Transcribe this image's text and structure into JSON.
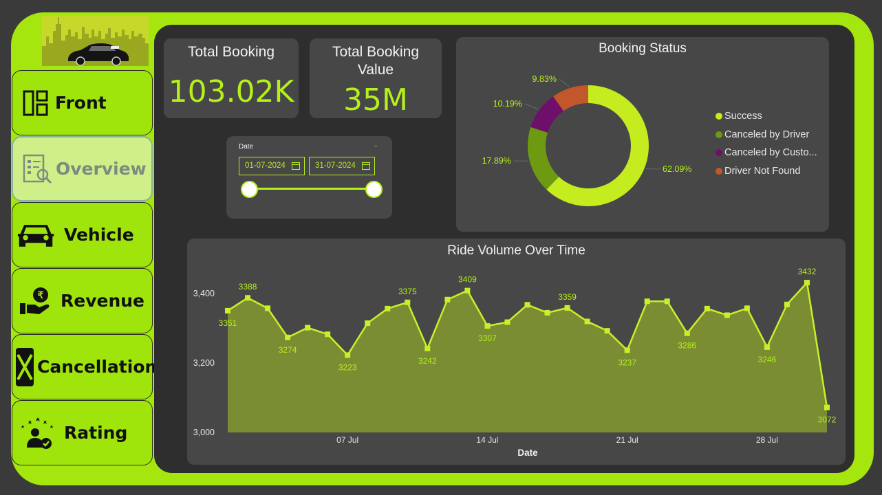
{
  "nav": [
    {
      "label": "Front",
      "icon": "layout-grid-icon"
    },
    {
      "label": "Overview",
      "icon": "report-search-icon"
    },
    {
      "label": "Vehicle",
      "icon": "car-icon"
    },
    {
      "label": "Revenue",
      "icon": "rupee-hand-icon"
    },
    {
      "label": "Cancellation",
      "icon": "cancel-x-icon"
    },
    {
      "label": "Rating",
      "icon": "rating-stars-user-icon"
    }
  ],
  "kpis": {
    "total_booking": {
      "title": "Total Booking",
      "value": "103.02K"
    },
    "total_booking_value": {
      "title_line1": "Total Booking",
      "title_line2": "Value",
      "value": "35M"
    }
  },
  "date_filter": {
    "label": "Date",
    "start": "01-07-2024",
    "end": "31-07-2024"
  },
  "colors": {
    "accent": "#b5f01a",
    "panel_green": "#a6e60f",
    "success": "#c4ec1e",
    "canceled_driver": "#6e9a12",
    "canceled_customer": "#6e0f6a",
    "driver_not_found": "#c2572b"
  },
  "chart_data": [
    {
      "type": "pie",
      "title": "Booking Status",
      "labels": [
        "Success",
        "Canceled by Driver",
        "Canceled by Custo...",
        "Driver Not Found"
      ],
      "values": [
        62.09,
        17.89,
        10.19,
        9.83
      ],
      "value_labels": [
        "62.09%",
        "17.89%",
        "10.19%",
        "9.83%"
      ],
      "legend": "right"
    },
    {
      "type": "area",
      "title": "Ride Volume Over Time",
      "xlabel": "Date",
      "ylabel": "",
      "ylim": [
        3000,
        3440
      ],
      "x_ticks": [
        "07 Jul",
        "14 Jul",
        "21 Jul",
        "28 Jul"
      ],
      "y_ticks": [
        "3,000",
        "3,200",
        "3,400"
      ],
      "x": [
        "2024-07-01",
        "2024-07-02",
        "2024-07-03",
        "2024-07-04",
        "2024-07-05",
        "2024-07-06",
        "2024-07-07",
        "2024-07-08",
        "2024-07-09",
        "2024-07-10",
        "2024-07-11",
        "2024-07-12",
        "2024-07-13",
        "2024-07-14",
        "2024-07-15",
        "2024-07-16",
        "2024-07-17",
        "2024-07-18",
        "2024-07-19",
        "2024-07-20",
        "2024-07-21",
        "2024-07-22",
        "2024-07-23",
        "2024-07-24",
        "2024-07-25",
        "2024-07-26",
        "2024-07-27",
        "2024-07-28",
        "2024-07-29",
        "2024-07-30",
        "2024-07-31"
      ],
      "values": [
        3351,
        3388,
        3358,
        3274,
        3302,
        3283,
        3223,
        3315,
        3357,
        3375,
        3242,
        3383,
        3409,
        3307,
        3318,
        3368,
        3345,
        3359,
        3320,
        3293,
        3237,
        3378,
        3378,
        3286,
        3357,
        3338,
        3358,
        3246,
        3369,
        3432,
        3072
      ],
      "data_labels": {
        "0": "3351",
        "1": "3388",
        "3": "3274",
        "6": "3223",
        "9": "3375",
        "10": "3242",
        "12": "3409",
        "13": "3307",
        "17": "3359",
        "20": "3237",
        "23": "3286",
        "27": "3246",
        "29": "3432",
        "30": "3072"
      }
    }
  ]
}
